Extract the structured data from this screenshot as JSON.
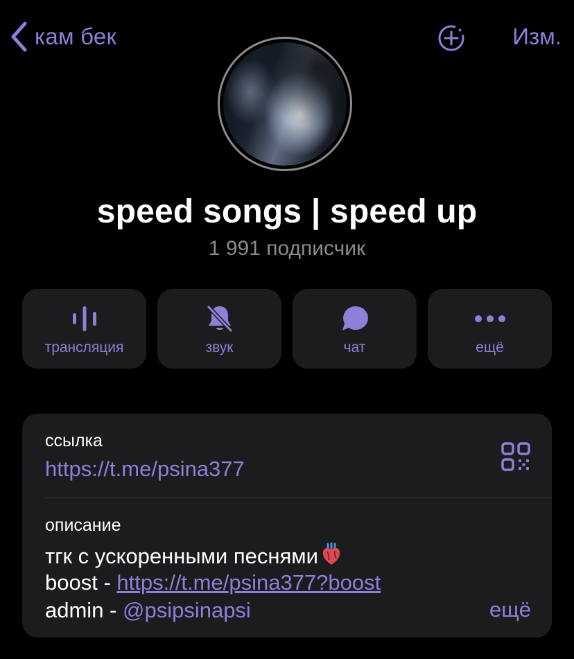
{
  "nav": {
    "back_label": "кам бек",
    "edit_label": "Изм."
  },
  "channel": {
    "title": "speed songs | speed up",
    "subscribers": "1 991 подписчик"
  },
  "actions": [
    {
      "label": "трансляция",
      "icon": "waveform-icon"
    },
    {
      "label": "звук",
      "icon": "bell-slash-icon"
    },
    {
      "label": "чат",
      "icon": "chat-bubble-icon"
    },
    {
      "label": "ещё",
      "icon": "more-dots-icon"
    }
  ],
  "info": {
    "link_caption": "ссылка",
    "link_value": "https://t.me/psina377",
    "description_caption": "описание",
    "description_line1": "тгк с ускоренными песнями",
    "description_line2_prefix": "boost - ",
    "description_line2_link": "https://t.me/psina377?boost",
    "description_line3_prefix": "admin - ",
    "description_line3_mention": "@psipsinapsi",
    "more_label": "ещё"
  },
  "colors": {
    "accent": "#8e7fd8",
    "background": "#000000",
    "card": "#1c1c1e",
    "secondary_text": "#8b8b90"
  }
}
